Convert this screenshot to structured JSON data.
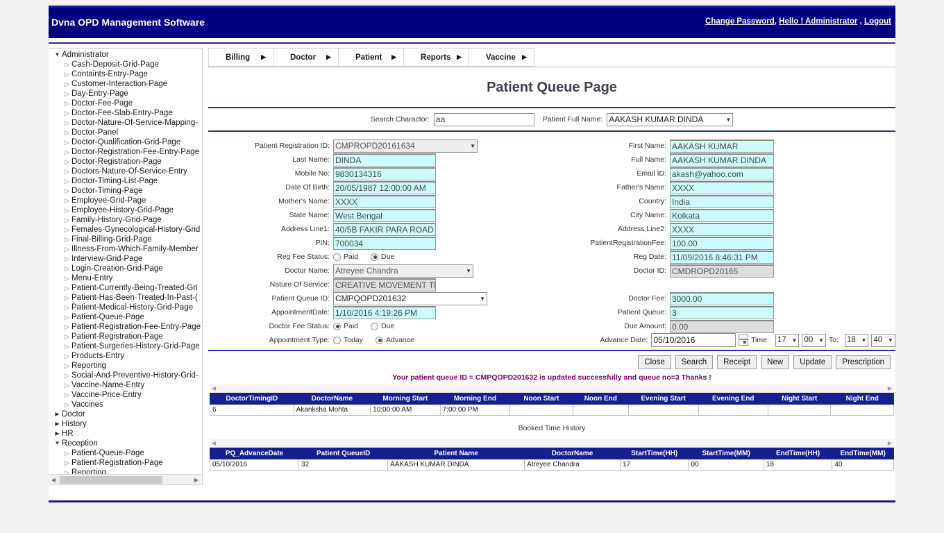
{
  "header": {
    "app_title": "Dvna OPD Management Software",
    "links": [
      {
        "label": "Change Password"
      },
      {
        "label": "Hello ! Administrator"
      },
      {
        "label": "Logout"
      }
    ],
    "links_separator_1": ", ",
    "links_separator_2": " , "
  },
  "sidebar": {
    "nodes": [
      {
        "label": "Administrator",
        "level": 1,
        "arrow": "▼"
      },
      {
        "label": "Cash-Deposit-Grid-Page",
        "level": 2,
        "arrow": "▷"
      },
      {
        "label": "Containts-Entry-Page",
        "level": 2,
        "arrow": "▷"
      },
      {
        "label": "Customer-Interaction-Page",
        "level": 2,
        "arrow": "▷"
      },
      {
        "label": "Day-Entry-Page",
        "level": 2,
        "arrow": "▷"
      },
      {
        "label": "Doctor-Fee-Page",
        "level": 2,
        "arrow": "▷"
      },
      {
        "label": "Doctor-Fee-Slab-Entry-Page",
        "level": 2,
        "arrow": "▷"
      },
      {
        "label": "Doctor-Nature-Of-Service-Mapping-",
        "level": 2,
        "arrow": "▷"
      },
      {
        "label": "Doctor-Panel",
        "level": 2,
        "arrow": "▷"
      },
      {
        "label": "Doctor-Qualification-Grid-Page",
        "level": 2,
        "arrow": "▷"
      },
      {
        "label": "Doctor-Registration-Fee-Entry-Page",
        "level": 2,
        "arrow": "▷"
      },
      {
        "label": "Doctor-Registration-Page",
        "level": 2,
        "arrow": "▷"
      },
      {
        "label": "Doctors-Nature-Of-Service-Entry",
        "level": 2,
        "arrow": "▷"
      },
      {
        "label": "Doctor-Timing-List-Page",
        "level": 2,
        "arrow": "▷"
      },
      {
        "label": "Doctor-Timing-Page",
        "level": 2,
        "arrow": "▷"
      },
      {
        "label": "Employee-Grid-Page",
        "level": 2,
        "arrow": "▷"
      },
      {
        "label": "Employee-History-Grid-Page",
        "level": 2,
        "arrow": "▷"
      },
      {
        "label": "Family-History-Grid-Page",
        "level": 2,
        "arrow": "▷"
      },
      {
        "label": "Females-Gynecological-History-Grid",
        "level": 2,
        "arrow": "▷"
      },
      {
        "label": "Final-Billing-Grid-Page",
        "level": 2,
        "arrow": "▷"
      },
      {
        "label": "Illness-From-Which-Family-Member",
        "level": 2,
        "arrow": "▷"
      },
      {
        "label": "Interview-Grid-Page",
        "level": 2,
        "arrow": "▷"
      },
      {
        "label": "Login-Creation-Grid-Page",
        "level": 2,
        "arrow": "▷"
      },
      {
        "label": "Menu-Entry",
        "level": 2,
        "arrow": "▷"
      },
      {
        "label": "Patient-Currently-Being-Treated-Gri",
        "level": 2,
        "arrow": "▷"
      },
      {
        "label": "Patient-Has-Been-Treated-In-Past-(",
        "level": 2,
        "arrow": "▷"
      },
      {
        "label": "Patient-Medical-History-Grid-Page",
        "level": 2,
        "arrow": "▷"
      },
      {
        "label": "Patient-Queue-Page",
        "level": 2,
        "arrow": "▷"
      },
      {
        "label": "Patient-Registration-Fee-Entry-Page",
        "level": 2,
        "arrow": "▷"
      },
      {
        "label": "Patient-Registration-Page",
        "level": 2,
        "arrow": "▷"
      },
      {
        "label": "Patient-Surgeries-History-Grid-Page",
        "level": 2,
        "arrow": "▷"
      },
      {
        "label": "Products-Entry",
        "level": 2,
        "arrow": "▷"
      },
      {
        "label": "Reporting",
        "level": 2,
        "arrow": "▷"
      },
      {
        "label": "Social-And-Preventive-History-Grid-",
        "level": 2,
        "arrow": "▷"
      },
      {
        "label": "Vaccine-Name-Entry",
        "level": 2,
        "arrow": "▷"
      },
      {
        "label": "Vaccine-Price-Entry",
        "level": 2,
        "arrow": "▷"
      },
      {
        "label": "Vaccines",
        "level": 2,
        "arrow": "▷"
      },
      {
        "label": "Doctor",
        "level": 1,
        "arrow": "▶"
      },
      {
        "label": "History",
        "level": 1,
        "arrow": "▶"
      },
      {
        "label": "HR",
        "level": 1,
        "arrow": "▶"
      },
      {
        "label": "Reception",
        "level": 1,
        "arrow": "▼"
      },
      {
        "label": "Patient-Queue-Page",
        "level": 2,
        "arrow": "▷"
      },
      {
        "label": "Patient-Registration-Page",
        "level": 2,
        "arrow": "▷"
      },
      {
        "label": "Reporting",
        "level": 2,
        "arrow": "▷"
      }
    ]
  },
  "menu": {
    "items": [
      {
        "label": "Billing",
        "caret": "▶"
      },
      {
        "label": "Doctor",
        "caret": "▶"
      },
      {
        "label": "Patient",
        "caret": "▶"
      },
      {
        "label": "Reports",
        "caret": "▶"
      },
      {
        "label": "Vaccine",
        "caret": "▶"
      }
    ]
  },
  "page": {
    "title": "Patient Queue Page"
  },
  "search": {
    "char_label": "Search Charactor:",
    "char_value": "aa",
    "full_name_label": "Patient Full Name:",
    "full_name_value": "AAKASH KUMAR DINDA",
    "caret": "▼"
  },
  "form": {
    "left": {
      "patient_reg_id_label": "Patient Registration ID:",
      "patient_reg_id_value": "CMPROPD20161634",
      "last_name_label": "Last Name:",
      "last_name_value": "DINDA",
      "mobile_label": "Mobile No:",
      "mobile_value": "9830134316",
      "dob_label": "Date Of Birth:",
      "dob_value": "20/05/1987 12:00:00 AM",
      "mother_label": "Mother's Name:",
      "mother_value": "XXXX",
      "state_label": "State Name:",
      "state_value": "West Bengal",
      "addr1_label": "Address Line1:",
      "addr1_value": "40/5B FAKIR PARA ROAD",
      "pin_label": "PIN:",
      "pin_value": "700034",
      "reg_fee_status_label": "Reg Fee Status:",
      "reg_fee_paid": "Paid",
      "reg_fee_due": "Due",
      "reg_fee_selected": "Due",
      "doctor_name_label": "Doctor Name:",
      "doctor_name_value": "Atreyee Chandra",
      "nature_label": "Nature Of Service:",
      "nature_value": "CREATIVE MOVEMENT TH",
      "queue_id_label": "Patient Queue ID:",
      "queue_id_value": "CMPQOPD201632",
      "appt_date_label": "AppointmentDate:",
      "appt_date_value": "1/10/2016 4:19:26 PM",
      "doc_fee_status_label": "Doctor Fee Status:",
      "doc_fee_paid": "Paid",
      "doc_fee_due": "Due",
      "doc_fee_selected": "Paid",
      "appt_type_label": "Appointment Type:",
      "appt_today": "Today",
      "appt_advance": "Advance",
      "appt_type_selected": "Advance"
    },
    "right": {
      "first_name_label": "First Name:",
      "first_name_value": "AAKASH KUMAR",
      "full_name_label": "Full Name:",
      "full_name_value": "AAKASH KUMAR DINDA",
      "email_label": "Email ID:",
      "email_value": "akash@yahoo.com",
      "father_label": "Father's Name:",
      "father_value": "XXXX",
      "country_label": "Country:",
      "country_value": "India",
      "city_label": "City Name:",
      "city_value": "Kolkata",
      "addr2_label": "Address Line2:",
      "addr2_value": "XXXX",
      "reg_fee_label": "PatientRegistrationFee:",
      "reg_fee_value": "100.00",
      "reg_date_label": "Reg Date:",
      "reg_date_value": "11/09/2016 8:46:31 PM",
      "doctor_id_label": "Doctor ID:",
      "doctor_id_value": "CMDROPD20165",
      "doctor_fee_label": "Doctor Fee:",
      "doctor_fee_value": "3000.00",
      "patient_queue_label": "Patient Queue:",
      "patient_queue_value": "3",
      "due_amount_label": "Due Amount:",
      "due_amount_value": "0.00",
      "advance_date_label": "Advance Date:",
      "advance_date_value": "05/10/2016",
      "time_label": "Time:",
      "time_from_hh": "17",
      "time_from_mm": "00",
      "to_label": "To:",
      "time_to_hh": "18",
      "time_to_mm": "40"
    }
  },
  "buttons": [
    {
      "label": "Close"
    },
    {
      "label": "Search"
    },
    {
      "label": "Receipt"
    },
    {
      "label": "New"
    },
    {
      "label": "Update"
    },
    {
      "label": "Prescription"
    }
  ],
  "status_message": "Your patient queue ID = CMPQOPD201632 is updated successfully and queue no=3 Thanks !",
  "doctor_timing_grid": {
    "columns": [
      "DoctorTimingID",
      "DoctorName",
      "Morning Start",
      "Morning End",
      "Noon Start",
      "Noon End",
      "Evening Start",
      "Evening End",
      "Night Start",
      "Night End"
    ],
    "rows": [
      [
        "6",
        "Akanksha Mohta",
        "10:00:00 AM",
        "7:00:00 PM",
        "",
        "",
        "",
        "",
        "",
        ""
      ]
    ]
  },
  "booked_time_history": {
    "title": "Booked Time History",
    "columns": [
      "PQ_AdvanceDate",
      "Patient QueueID",
      "Patient Name",
      "DoctorName",
      "StartTime(HH)",
      "StartTime(MM)",
      "EndTime(HH)",
      "EndTime(MM)"
    ],
    "rows": [
      [
        "05/10/2016",
        "32",
        "AAKASH KUMAR DINDA",
        "Atreyee Chandra",
        "17",
        "00",
        "18",
        "40"
      ]
    ]
  },
  "icons": {
    "scroll_left": "◀",
    "scroll_right": "▶",
    "caret_down": "▼",
    "calendar": "calendar-icon"
  },
  "colors": {
    "header_bg": "#000080",
    "accent_rule": "#2a2ab0",
    "grid_header": "#151f8f",
    "field_cyan": "#ccfbfd",
    "field_grey": "#dedede",
    "status_text": "#800060"
  }
}
